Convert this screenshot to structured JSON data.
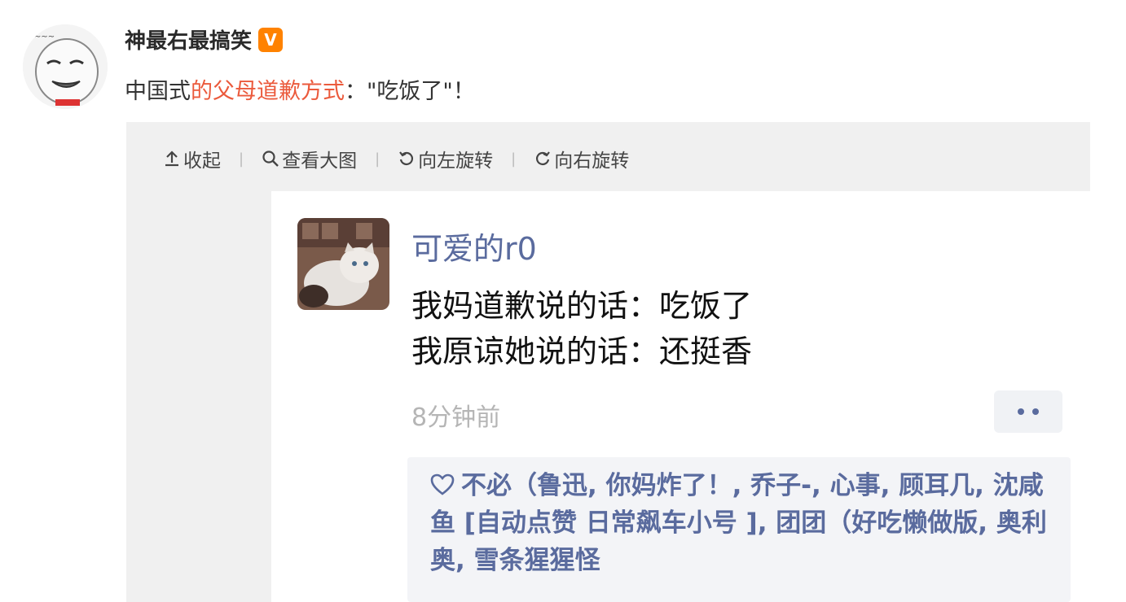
{
  "post": {
    "author": "神最右最搞笑",
    "vip_badge": "V",
    "text_prefix": "中国式",
    "text_highlight": "的父母道歉方式",
    "text_suffix": "：\"吃饭了\"！"
  },
  "toolbar": {
    "collapse": "收起",
    "view_large": "查看大图",
    "rotate_left": "向左旋转",
    "rotate_right": "向右旋转",
    "separator": "|"
  },
  "screenshot": {
    "nickname": "可爱的r0",
    "line1": "我妈道歉说的话：吃饭了",
    "line2": "我原谅她说的话：还挺香",
    "time": "8分钟前",
    "likes": "不必（鲁迅, 你妈炸了！, 乔子-, 心事, 顾耳几, 沈咸鱼 [自动点赞 日常飙车小号 ], 团团（好吃懒做版, 奥利奥, 雪条猩猩怪"
  },
  "colors": {
    "highlight": "#eb5a3c",
    "link_blue": "#5a6b9e",
    "vip_orange": "#ff8200",
    "media_bg": "#f0f0f0"
  },
  "icons": [
    "upload-icon",
    "search-icon",
    "rotate-left-icon",
    "rotate-right-icon",
    "heart-icon",
    "more-icon"
  ]
}
